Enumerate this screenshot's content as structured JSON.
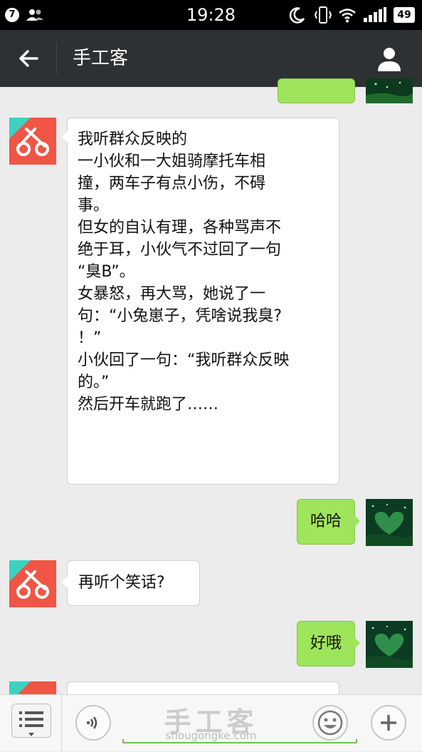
{
  "status_bar": {
    "notification_count": "7",
    "time": "19:28",
    "battery": "49"
  },
  "header": {
    "title": "手工客",
    "back_icon": "arrow-left-icon",
    "profile_icon": "person-icon"
  },
  "colors": {
    "header_bg": "#2e3134",
    "sent_bubble": "#9fe55b",
    "received_bubble": "#ffffff",
    "chat_bg": "#ececec",
    "avatar_bg": "#f05545"
  },
  "messages": [
    {
      "from": "me",
      "text": ""
    },
    {
      "from": "bot",
      "lines": [
        "我听群众反映的",
        "",
        "一小伙和一大姐骑摩托车相",
        "撞，两车子有点小伤，不碍",
        "事。",
        "但女的自认有理，各种骂声不",
        "绝于耳，小伙气不过回了一句",
        "“臭B”。",
        "女暴怒，再大骂，她说了一",
        "句：“小兔崽子，凭啥说我臭?",
        "！”",
        "小伙回了一句：“我听群众反映",
        "的。”",
        "然后开车就跑了……"
      ]
    },
    {
      "from": "me",
      "text": "哈哈"
    },
    {
      "from": "bot",
      "text": "再听个笑话?"
    },
    {
      "from": "me",
      "text": "好哦"
    },
    {
      "from": "bot",
      "text": ""
    }
  ],
  "input_bar": {
    "menu_icon": "list-menu-icon",
    "voice_icon": "voice-icon",
    "emoji_icon": "emoji-icon",
    "add_icon": "plus-icon"
  },
  "watermark": {
    "title": "手工客",
    "url": "shougongke.com"
  }
}
